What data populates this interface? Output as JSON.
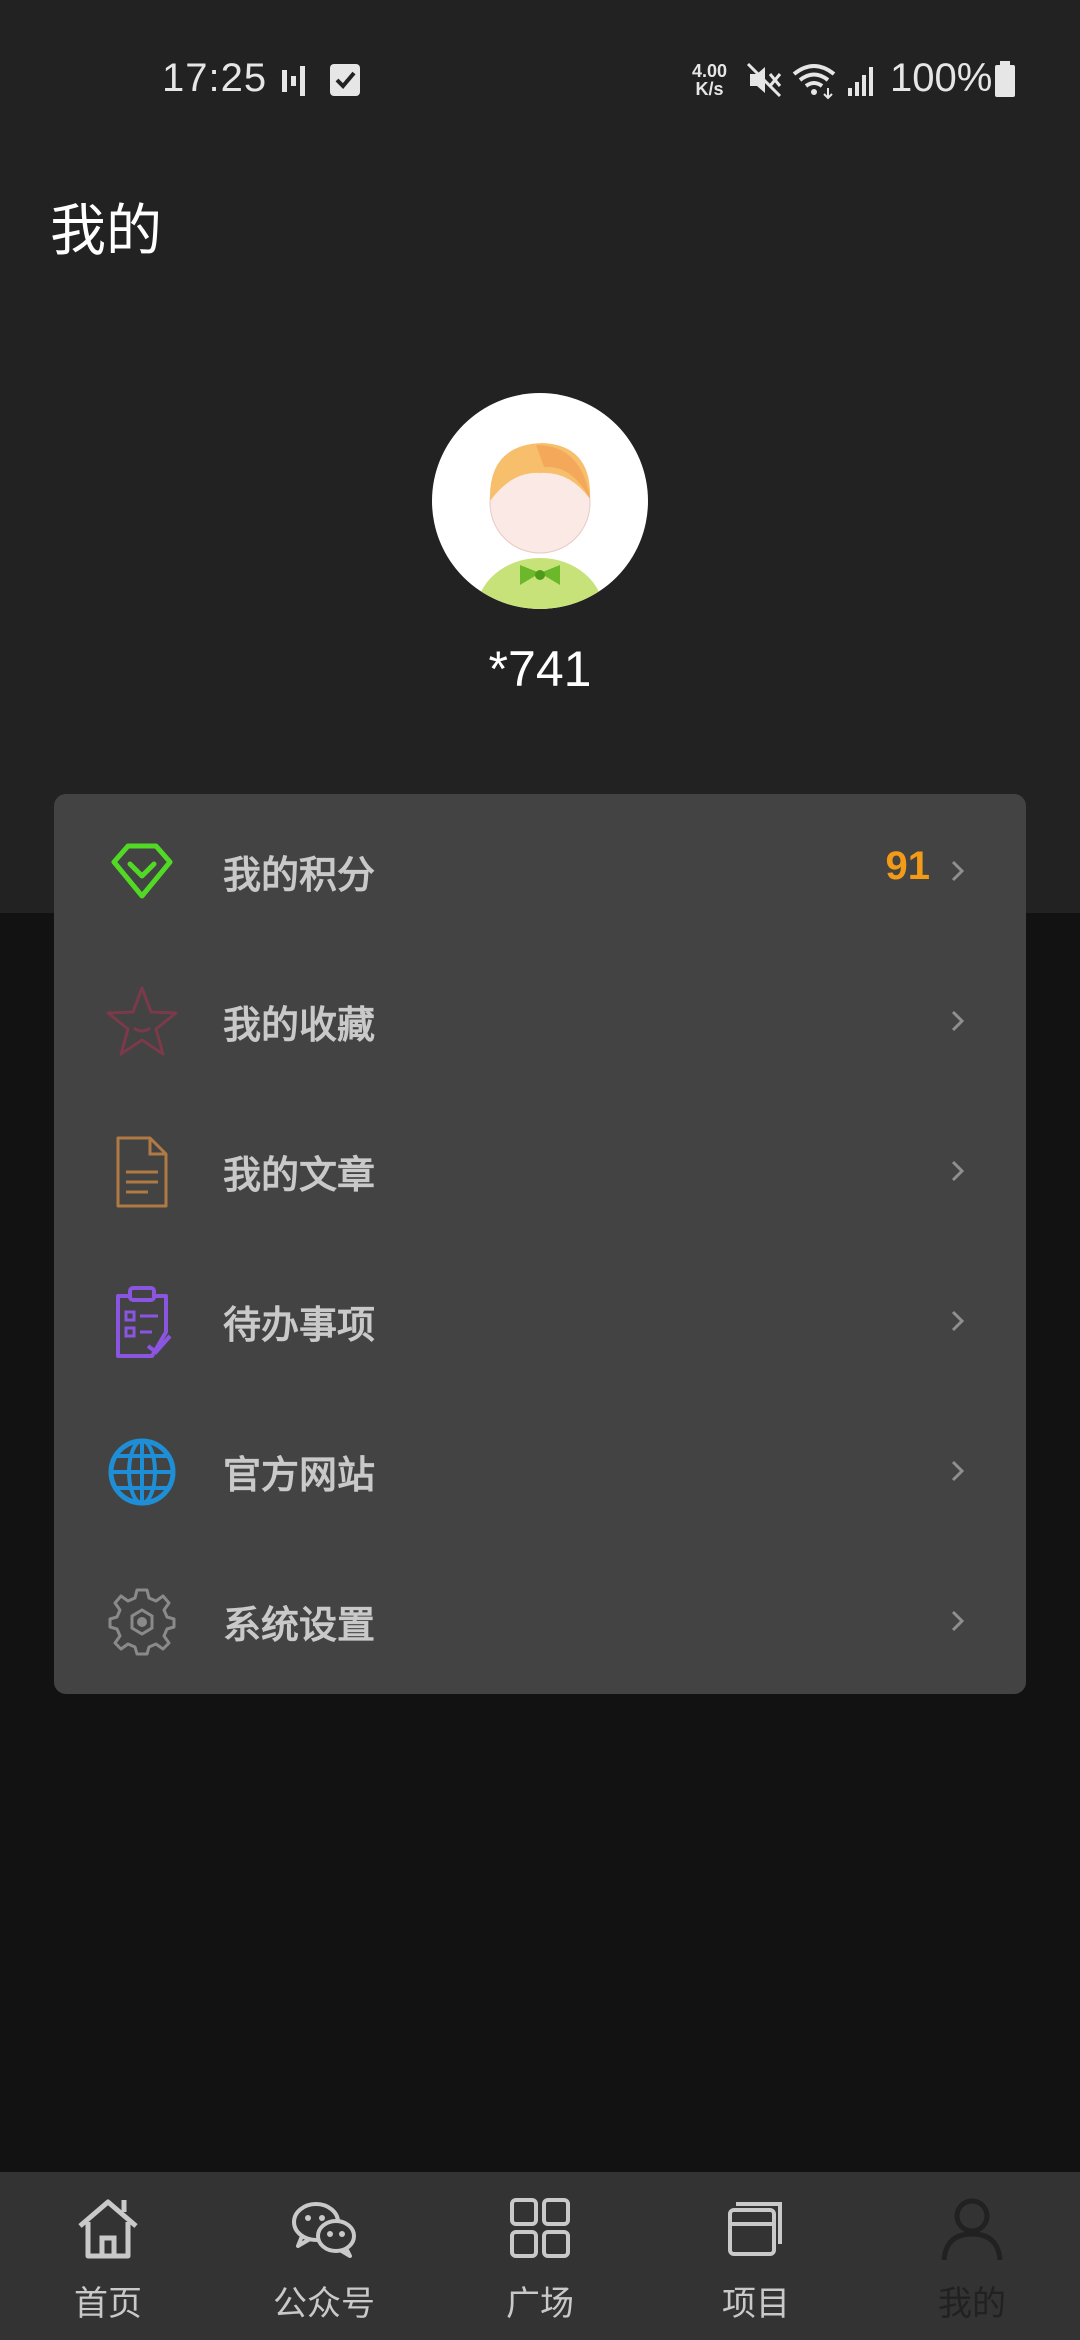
{
  "status_bar": {
    "time": "17:25",
    "net_speed_value": "4.00",
    "net_speed_unit": "K/s",
    "battery": "100%"
  },
  "page": {
    "title": "我的"
  },
  "profile": {
    "username": "*741"
  },
  "menu": {
    "items": [
      {
        "label": "我的积分",
        "value": "91",
        "icon": "diamond-icon",
        "color": "#52d926"
      },
      {
        "label": "我的收藏",
        "value": "",
        "icon": "star-icon",
        "color": "#7a3a4a"
      },
      {
        "label": "我的文章",
        "value": "",
        "icon": "document-icon",
        "color": "#b07a45"
      },
      {
        "label": "待办事项",
        "value": "",
        "icon": "clipboard-icon",
        "color": "#8a55e0"
      },
      {
        "label": "官方网站",
        "value": "",
        "icon": "globe-icon",
        "color": "#1e8fd6"
      },
      {
        "label": "系统设置",
        "value": "",
        "icon": "gear-icon",
        "color": "#8a8a8a"
      }
    ]
  },
  "bottom_nav": {
    "items": [
      {
        "label": "首页",
        "icon": "home-icon"
      },
      {
        "label": "公众号",
        "icon": "wechat-icon"
      },
      {
        "label": "广场",
        "icon": "grid-icon"
      },
      {
        "label": "项目",
        "icon": "project-icon"
      },
      {
        "label": "我的",
        "icon": "user-icon",
        "active": true
      }
    ]
  },
  "colors": {
    "accent_value": "#f39a17",
    "header_bg": "#222223",
    "card_bg": "#434343"
  }
}
